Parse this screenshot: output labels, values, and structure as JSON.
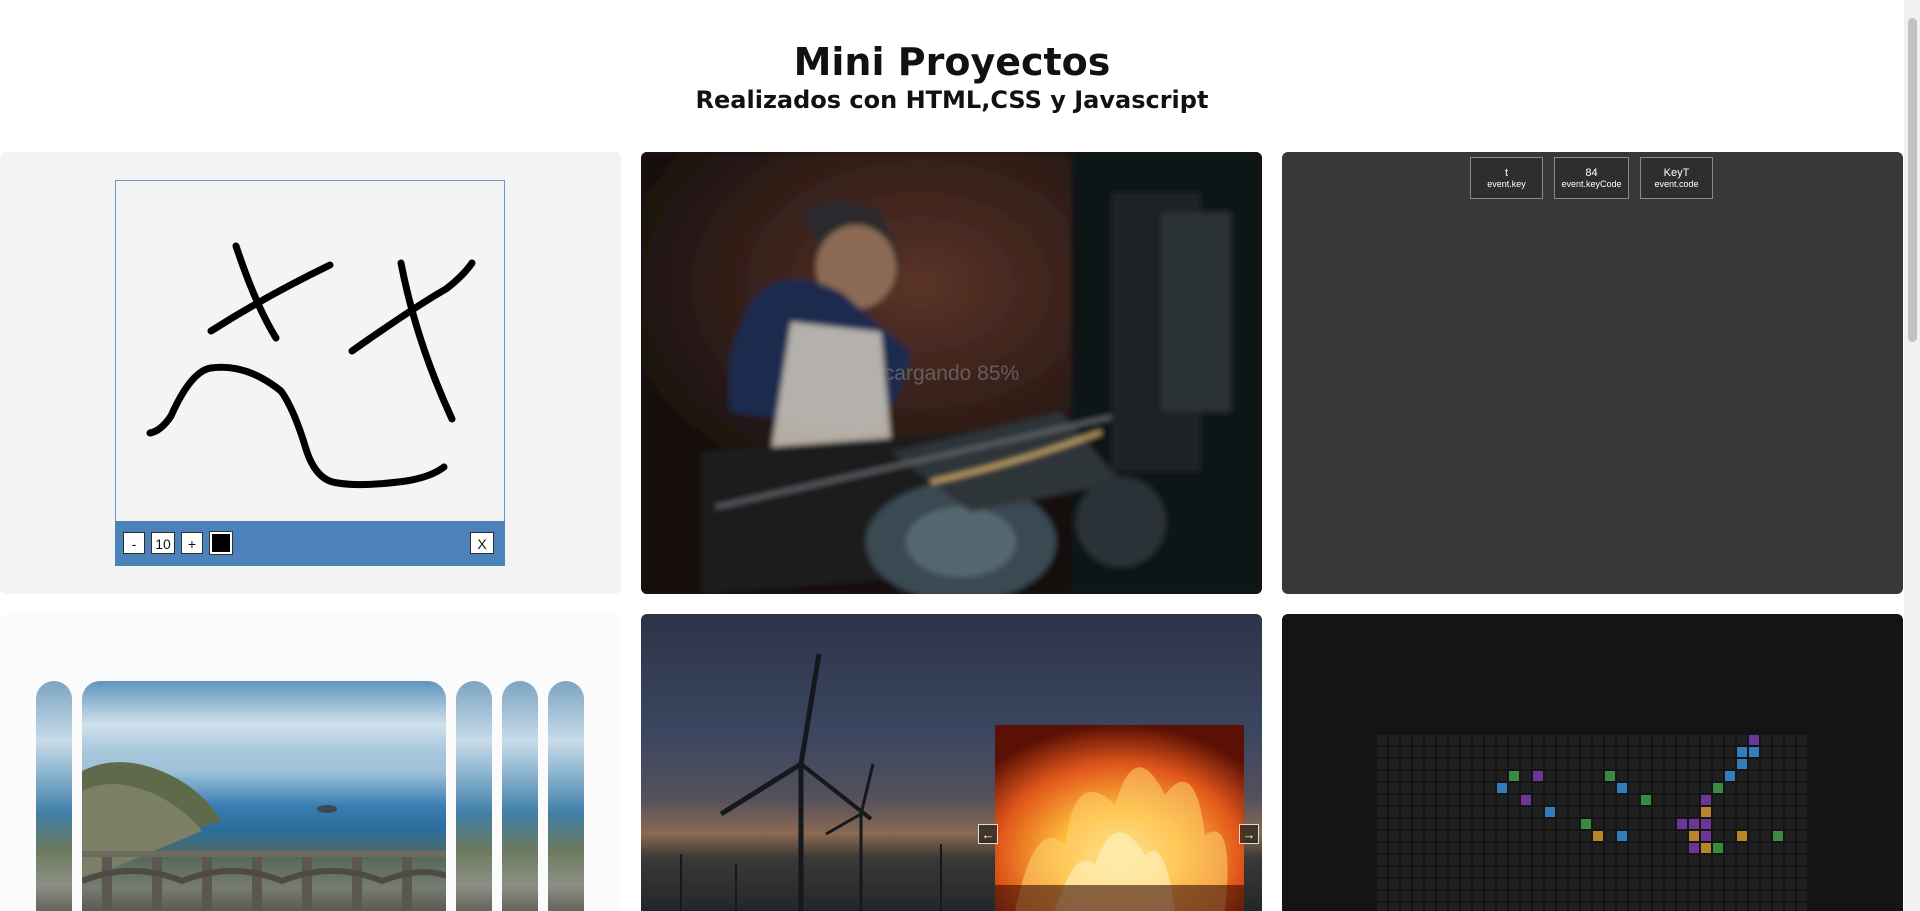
{
  "header": {
    "title": "Mini Proyectos",
    "subtitle": "Realizados con HTML,CSS y Javascript"
  },
  "drawing": {
    "decrease_label": "-",
    "size_value": "10",
    "increase_label": "+",
    "clear_label": "X",
    "brush_color": "#000000",
    "toolbar_color": "#4a82b9"
  },
  "loader": {
    "loading_text": "cargando 85%",
    "progress_percent": 85
  },
  "keyboard": {
    "boxes": [
      {
        "value": "t",
        "label": "event.key"
      },
      {
        "value": "84",
        "label": "event.keyCode"
      },
      {
        "value": "KeyT",
        "label": "event.code"
      }
    ]
  },
  "slider": {
    "prev_icon": "arrow-left-icon",
    "next_icon": "arrow-right-icon",
    "prev_glyph": "←",
    "next_glyph": "→"
  },
  "colors": {
    "accent_blue": "#4a82b9",
    "dark_card": "#383838",
    "grid_card": "#141414"
  }
}
